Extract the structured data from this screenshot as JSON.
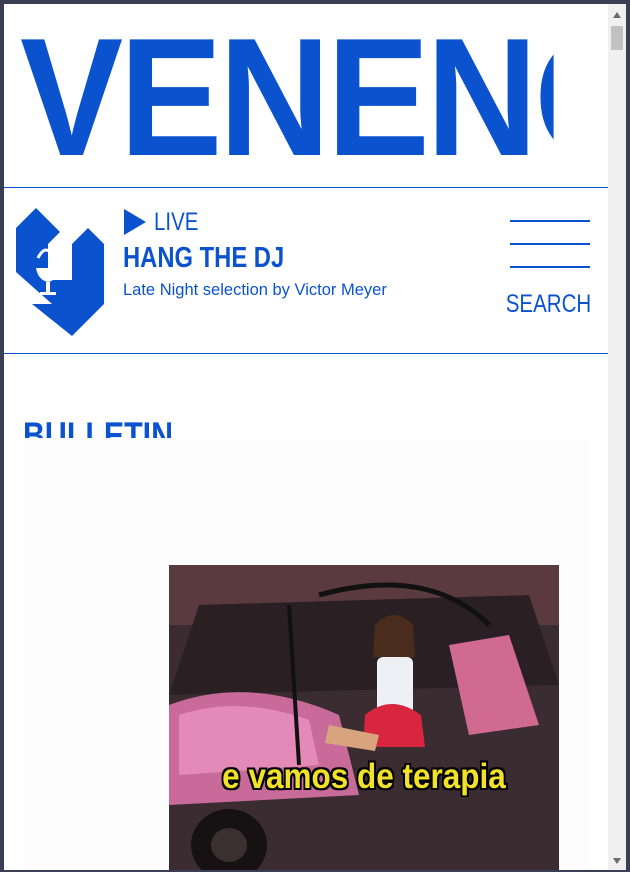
{
  "site": {
    "logo_text": "VENENO"
  },
  "player": {
    "live_label": "LIVE",
    "show_title": "HANG THE DJ",
    "show_subtitle": "Late Night selection by Victor Meyer"
  },
  "nav": {
    "search_label": "SEARCH"
  },
  "section": {
    "title": "BULLETIN"
  },
  "media": {
    "caption": "e vamos de terapia"
  },
  "colors": {
    "brand": "#0b53ce",
    "caption": "#f1e227"
  }
}
